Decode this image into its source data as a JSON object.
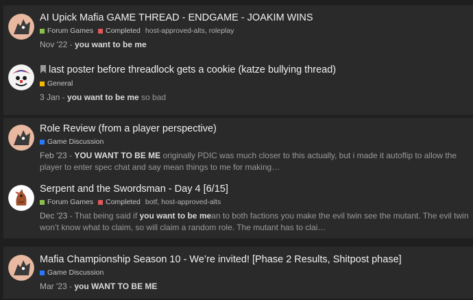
{
  "results": [
    {
      "title": "AI Upick Mafia GAME THREAD - ENDGAME - JOAKIM WINS",
      "category": "Forum Games",
      "category_color": "#8bc34a",
      "status": "Completed",
      "status_color": "#e45757",
      "tags": "host-approved-alts, roleplay",
      "date": "Nov '22",
      "sep": " - ",
      "highlight": "you want to be me",
      "rest": ""
    },
    {
      "title": "last poster before threadlock gets a cookie (katze bullying thread)",
      "category": "General",
      "category_color": "#f5b800",
      "date": "3 Jan",
      "sep": " - ",
      "highlight": "you want to be me",
      "rest": " so bad"
    },
    {
      "title": "Role Review (from a player perspective)",
      "category": "Game Discussion",
      "category_color": "#2979ff",
      "date": "Feb '23",
      "sep": " - ",
      "highlight": "YOU WANT TO BE ME",
      "rest": " originally PDIC was much closer to this actually, but i made it autoflip to allow the player to enter spec chat and say mean things to me for making…"
    },
    {
      "title": "Serpent and the Swordsman - Day 4 [6/15]",
      "category": "Forum Games",
      "category_color": "#8bc34a",
      "status": "Completed",
      "status_color": "#e45757",
      "tags": "botf, host-approved-alts",
      "date": "Dec '23",
      "pre": " - That being said if ",
      "highlight": "you want to be me",
      "rest": "an to both factions you make the evil twin see the mutant. The evil twin won’t know what to claim, so will claim a random role. The mutant has to clai…"
    },
    {
      "title": "Mafia Championship Season 10 - We’re invited! [Phase 2 Results, Shitpost phase]",
      "category": "Game Discussion",
      "category_color": "#2979ff",
      "date": "Mar '23",
      "sep": " - ",
      "highlight": "you WANT TO BE ME",
      "rest": ""
    }
  ]
}
